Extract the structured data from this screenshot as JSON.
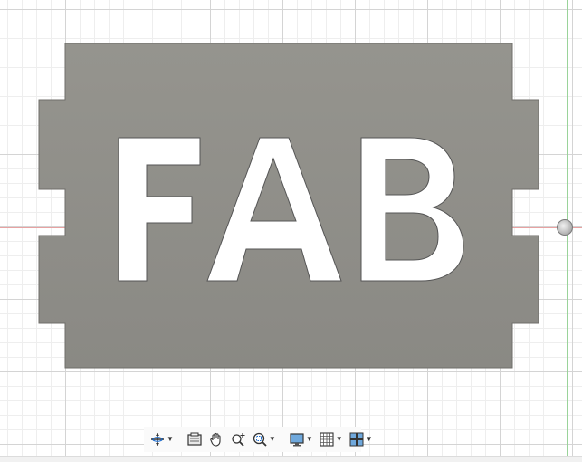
{
  "viewport": {
    "part_text": "FAB",
    "part_color": "#8e8d88",
    "letter_color": "#ffffff",
    "grid_major_color": "#d4d4d4",
    "grid_minor_color": "#eeeeee",
    "x_axis_color": "#e7a2a2",
    "y_axis_color": "#9ad39a"
  },
  "toolbar": {
    "items": [
      {
        "name": "orbit-button",
        "icon": "orbit-icon",
        "has_dropdown": true
      },
      {
        "name": "look-at-button",
        "icon": "look-at-icon",
        "has_dropdown": false
      },
      {
        "name": "pan-button",
        "icon": "hand-icon",
        "has_dropdown": false
      },
      {
        "name": "zoom-button",
        "icon": "zoom-icon",
        "has_dropdown": false
      },
      {
        "name": "fit-button",
        "icon": "zoom-window-icon",
        "has_dropdown": true
      },
      {
        "name": "display-settings-button",
        "icon": "monitor-icon",
        "has_dropdown": true
      },
      {
        "name": "grid-settings-button",
        "icon": "grid-icon",
        "has_dropdown": true
      },
      {
        "name": "viewports-button",
        "icon": "viewports-icon",
        "has_dropdown": true
      }
    ]
  }
}
